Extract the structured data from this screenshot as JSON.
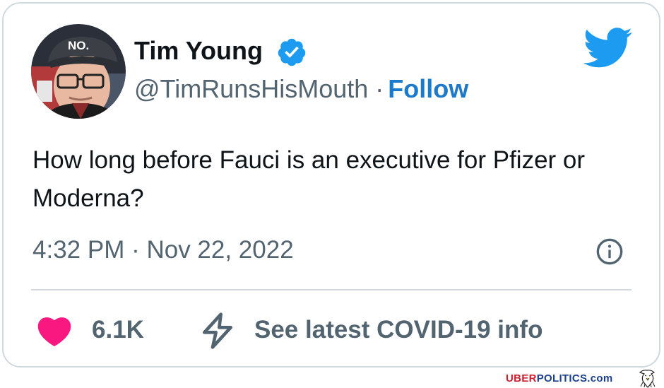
{
  "tweet": {
    "author_name": "Tim Young",
    "handle": "@TimRunsHisMouth",
    "separator": "·",
    "follow_label": "Follow",
    "text": "How long before Fauci is an executive for Pfizer or Moderna?",
    "timestamp": "4:32 PM · Nov 22, 2022",
    "likes_count": "6.1K",
    "covid_info_label": "See latest COVID-19 info",
    "avatar_hat_text": "NO."
  },
  "icons": {
    "verified": "verified-badge-icon",
    "brand": "twitter-bird-icon",
    "info": "info-icon",
    "like": "heart-icon",
    "covid": "lightning-bolt-icon"
  },
  "watermark": {
    "part1": "UBER",
    "part2": "POLITICS",
    "part3": ".com"
  },
  "colors": {
    "accent_blue": "#1d79c9",
    "twitter_blue": "#1d9bf0",
    "like_pink": "#f91880",
    "text_primary": "#0f1419",
    "text_secondary": "#536471",
    "border": "#cfd9de"
  }
}
